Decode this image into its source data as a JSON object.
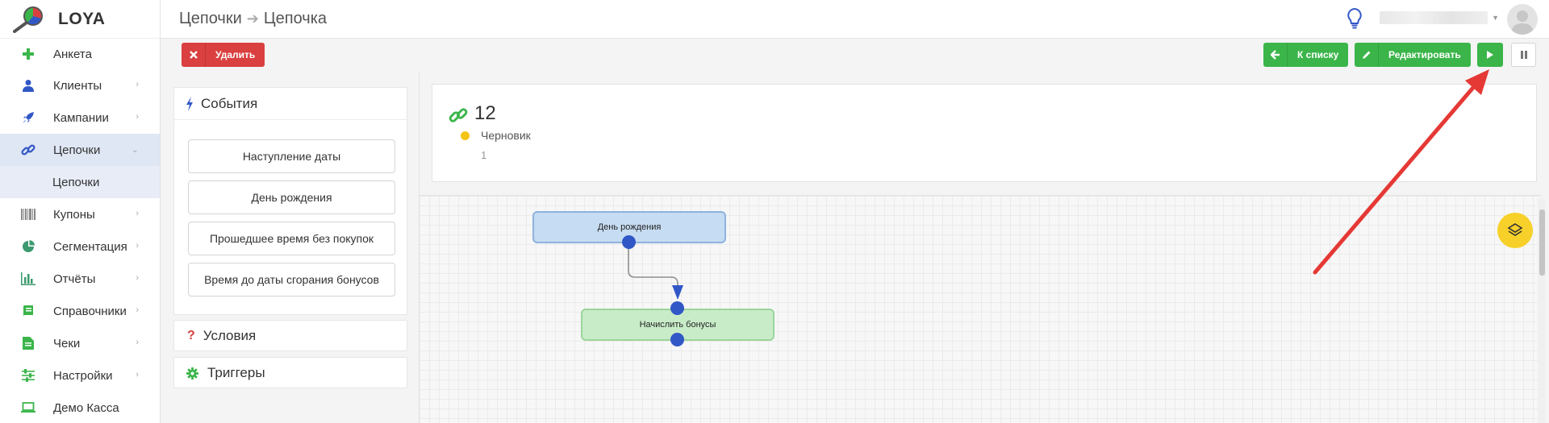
{
  "app": {
    "name": "LOYA"
  },
  "sidebar": {
    "items": [
      {
        "label": "Анкета",
        "icon": "plus-icon",
        "color": "#3bb54a"
      },
      {
        "label": "Клиенты",
        "icon": "user-icon",
        "color": "#3157c7"
      },
      {
        "label": "Кампании",
        "icon": "rocket-icon",
        "color": "#3157c7"
      },
      {
        "label": "Цепочки",
        "icon": "link-icon",
        "color": "#3157c7"
      },
      {
        "label": "Купоны",
        "icon": "barcode-icon",
        "color": "#888888"
      },
      {
        "label": "Сегментация",
        "icon": "pie-chart-icon",
        "color": "#3b9a6e"
      },
      {
        "label": "Отчёты",
        "icon": "bar-chart-icon",
        "color": "#3b9a6e"
      },
      {
        "label": "Справочники",
        "icon": "book-icon",
        "color": "#3bb54a"
      },
      {
        "label": "Чеки",
        "icon": "document-icon",
        "color": "#3bb54a"
      },
      {
        "label": "Настройки",
        "icon": "sliders-icon",
        "color": "#3bb54a"
      },
      {
        "label": "Демо Касса",
        "icon": "laptop-icon",
        "color": "#3bb54a"
      }
    ],
    "sub_item": {
      "label": "Цепочки"
    }
  },
  "header": {
    "breadcrumb_parent": "Цепочки",
    "breadcrumb_current": "Цепочка"
  },
  "toolbar": {
    "delete_label": "Удалить",
    "back_label": "К списку",
    "edit_label": "Редактировать"
  },
  "events_panel": {
    "title": "События",
    "buttons": [
      "Наступление даты",
      "День рождения",
      "Прошедшее время без покупок",
      "Время до даты сгорания бонусов"
    ]
  },
  "conditions_panel": {
    "title": "Условия"
  },
  "triggers_panel": {
    "title": "Триггеры"
  },
  "chain": {
    "number": "12",
    "status": "Черновик",
    "status_color": "#f3c316",
    "count": "1"
  },
  "canvas": {
    "node_event": "День рождения",
    "node_action": "Начислить бонусы"
  },
  "colors": {
    "accent_green": "#3bb54a",
    "danger_red": "#d9403f",
    "node_port": "#3157c7",
    "annotation_arrow": "#e53935"
  }
}
